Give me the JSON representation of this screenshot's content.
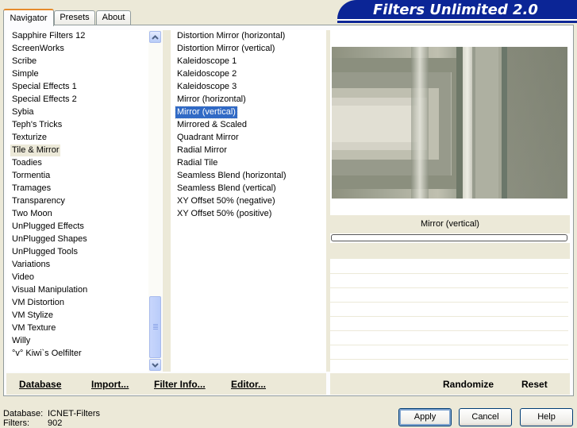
{
  "tabs": [
    {
      "label": "Navigator",
      "active": true
    },
    {
      "label": "Presets",
      "active": false
    },
    {
      "label": "About",
      "active": false
    }
  ],
  "banner": {
    "title": "Filters Unlimited 2.0",
    "color": "#0B2596"
  },
  "categories": {
    "items": [
      "Sapphire Filters 12",
      "ScreenWorks",
      "Scribe",
      "Simple",
      "Special Effects 1",
      "Special Effects 2",
      "Sybia",
      "Teph's Tricks",
      "Texturize",
      "Tile & Mirror",
      "Toadies",
      "Tormentia",
      "Tramages",
      "Transparency",
      "Two Moon",
      "UnPlugged Effects",
      "UnPlugged Shapes",
      "UnPlugged Tools",
      "Variations",
      "Video",
      "Visual Manipulation",
      "VM Distortion",
      "VM Stylize",
      "VM Texture",
      "Willy",
      "°v° Kiwi`s Oelfilter"
    ],
    "selected": "Tile & Mirror"
  },
  "filters": {
    "items": [
      "Distortion Mirror (horizontal)",
      "Distortion Mirror (vertical)",
      "Kaleidoscope 1",
      "Kaleidoscope 2",
      "Kaleidoscope 3",
      "Mirror (horizontal)",
      "Mirror (vertical)",
      "Mirrored & Scaled",
      "Quadrant Mirror",
      "Radial Mirror",
      "Radial Tile",
      "Seamless Blend (horizontal)",
      "Seamless Blend (vertical)",
      "XY Offset 50% (negative)",
      "XY Offset 50% (positive)"
    ],
    "selected": "Mirror (vertical)"
  },
  "preview": {
    "filter_name": "Mirror (vertical)",
    "progress": 0
  },
  "left_bar": {
    "database": "Database",
    "import": "Import...",
    "filter_info": "Filter Info...",
    "editor": "Editor..."
  },
  "right_bar": {
    "randomize": "Randomize",
    "reset": "Reset"
  },
  "status": {
    "database_label": "Database:",
    "database_value": "ICNET-Filters",
    "filters_label": "Filters:",
    "filters_value": "902"
  },
  "buttons": {
    "apply": "Apply",
    "cancel": "Cancel",
    "help": "Help"
  },
  "colors": {
    "selection": "#316AC5",
    "face": "#ECE9D8",
    "accent_tab": "#E68B2C"
  }
}
